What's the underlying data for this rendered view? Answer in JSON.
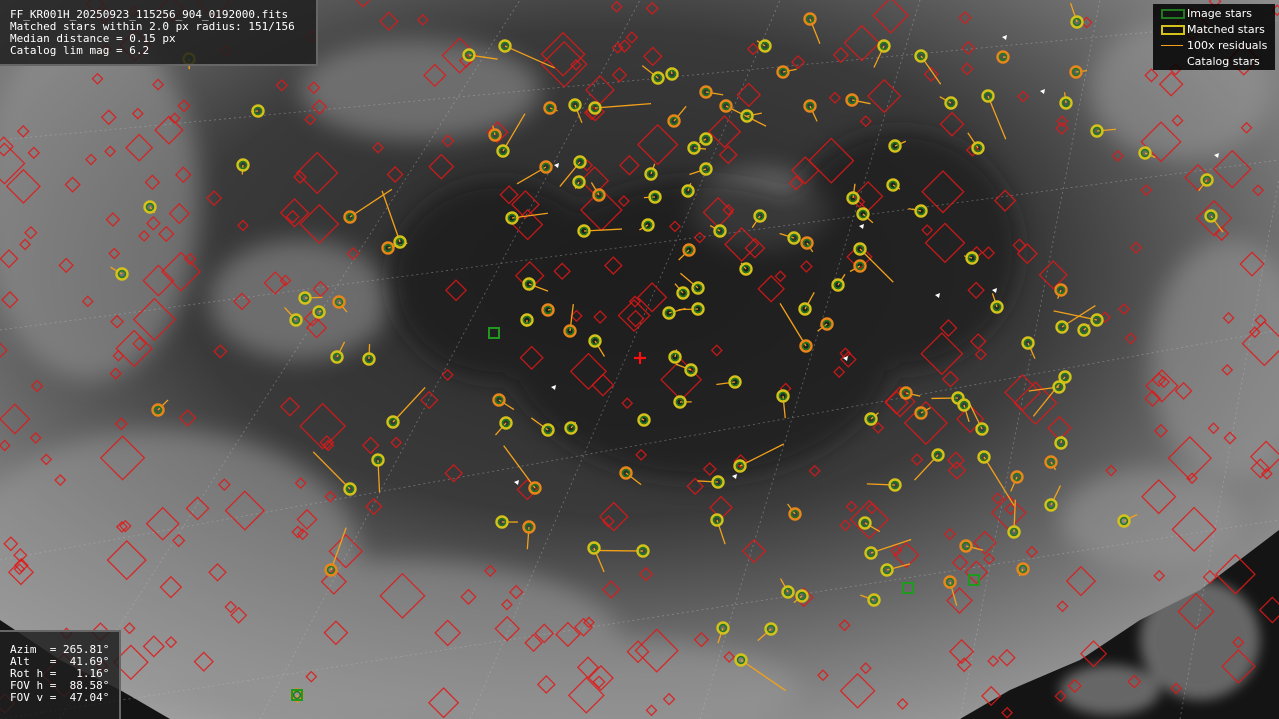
{
  "info": {
    "filename": "FF_KR001H_20250923_115256_904_0192000.fits",
    "matched": "Matched stars within 2.0 px radius: 151/156",
    "median": "Median distance = 0.15 px",
    "catalog_lim": "Catalog lim mag = 6.2"
  },
  "pointing": {
    "azim": "Azim  = 265.81°",
    "alt": "Alt   =  41.69°",
    "rot": "Rot h =   1.16°",
    "fov_h": "FOV h =  88.58°",
    "fov_v": "FOV v =  47.04°"
  },
  "legend": {
    "image_stars": "Image stars",
    "matched_stars": "Matched stars",
    "residuals": "100x residuals",
    "catalog_stars": "Catalog stars"
  },
  "colors": {
    "image_star": "#1f7a1f",
    "matched_star": "#d4c21a",
    "residual": "#f2a11a",
    "catalog_star": "#e01818",
    "center_marker": "#ff1010"
  }
}
